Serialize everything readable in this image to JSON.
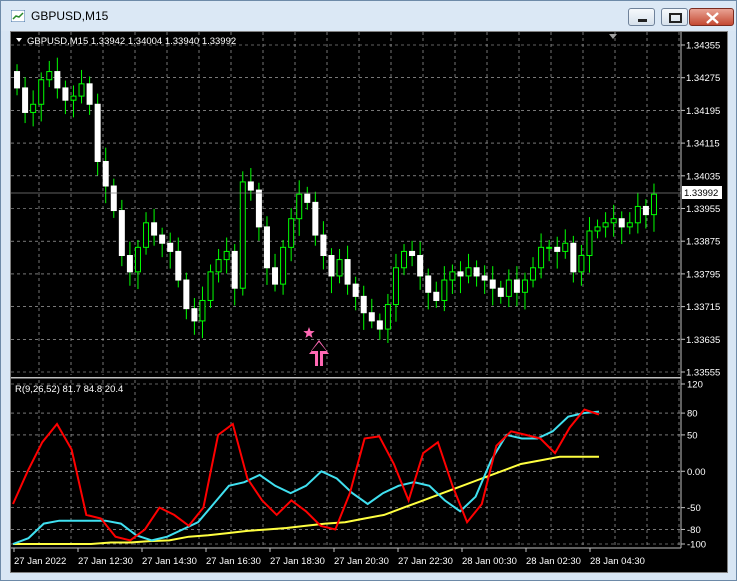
{
  "window": {
    "title": "GBPUSD,M15"
  },
  "price_panel": {
    "header": "GBPUSD,M15  1.33942 1.34004 1.33940 1.33992",
    "current_price": "1.33992",
    "axis_labels": [
      "1.34355",
      "1.34275",
      "1.34195",
      "1.34115",
      "1.34035",
      "1.33955",
      "1.33875",
      "1.33795",
      "1.33715",
      "1.33635",
      "1.33555"
    ]
  },
  "indicator_panel": {
    "header": "R(9,26,52) 81.7 84.8 20.4",
    "axis_labels": [
      "120",
      "80",
      "50",
      "0.00",
      "-50",
      "-80",
      "-100"
    ]
  },
  "time_labels": [
    "27 Jan 2022",
    "27 Jan 12:30",
    "27 Jan 14:30",
    "27 Jan 16:30",
    "27 Jan 18:30",
    "27 Jan 20:30",
    "27 Jan 22:30",
    "28 Jan 00:30",
    "28 Jan 02:30",
    "28 Jan 04:30"
  ],
  "colors": {
    "bull": "#ffffff",
    "bear": "#00ff00",
    "grid": "#c0c0c0",
    "red": "#ff0000",
    "cyan": "#40e0f0",
    "yellow": "#ffff40",
    "marker": "#ff69b4"
  },
  "chart_data": {
    "type": "candlestick",
    "y_range": [
      1.33555,
      1.34355
    ],
    "candles_close": [
      1.3425,
      1.3419,
      1.3421,
      1.3427,
      1.3429,
      1.3425,
      1.3422,
      1.3423,
      1.3426,
      1.3421,
      1.3407,
      1.3401,
      1.3395,
      1.3384,
      1.338,
      1.3386,
      1.3392,
      1.3389,
      1.3387,
      1.3385,
      1.3378,
      1.3371,
      1.3368,
      1.3373,
      1.338,
      1.3383,
      1.3385,
      1.3376,
      1.3402,
      1.34,
      1.3391,
      1.3381,
      1.3377,
      1.3386,
      1.3393,
      1.3399,
      1.3397,
      1.3389,
      1.3384,
      1.3379,
      1.3383,
      1.3377,
      1.3374,
      1.337,
      1.3368,
      1.3366,
      1.3372,
      1.3381,
      1.3385,
      1.3384,
      1.3379,
      1.3375,
      1.3373,
      1.3378,
      1.338,
      1.3379,
      1.3381,
      1.3379,
      1.3378,
      1.3376,
      1.3374,
      1.3378,
      1.3375,
      1.3378,
      1.3381,
      1.3386,
      1.3386,
      1.3385,
      1.3387,
      1.338,
      1.3384,
      1.339,
      1.3391,
      1.3392,
      1.3393,
      1.3391,
      1.3392,
      1.3396,
      1.3394,
      1.3399
    ],
    "rsi_red": [
      -45,
      0,
      40,
      65,
      30,
      -60,
      -65,
      -90,
      -95,
      -80,
      -50,
      -60,
      -75,
      -50,
      50,
      65,
      -10,
      -40,
      -60,
      -40,
      -55,
      -75,
      -80,
      -30,
      45,
      48,
      10,
      -40,
      25,
      40,
      -20,
      -70,
      -45,
      35,
      55,
      50,
      45,
      25,
      60,
      85,
      78
    ],
    "rsi_cyan": [
      -100,
      -92,
      -72,
      -68,
      -68,
      -68,
      -68,
      -72,
      -88,
      -95,
      -90,
      -80,
      -70,
      -45,
      -20,
      -15,
      -5,
      -20,
      -30,
      -20,
      0,
      -10,
      -30,
      -45,
      -30,
      -20,
      -15,
      -20,
      -40,
      -55,
      -35,
      15,
      50,
      45,
      45,
      55,
      75,
      80,
      82
    ],
    "rsi_yellow": [
      -100,
      -100,
      -100,
      -100,
      -100,
      -98,
      -98,
      -96,
      -95,
      -90,
      -88,
      -85,
      -82,
      -80,
      -78,
      -75,
      -72,
      -70,
      -65,
      -60,
      -50,
      -40,
      -30,
      -20,
      -10,
      0,
      10,
      15,
      20,
      20,
      20
    ]
  }
}
